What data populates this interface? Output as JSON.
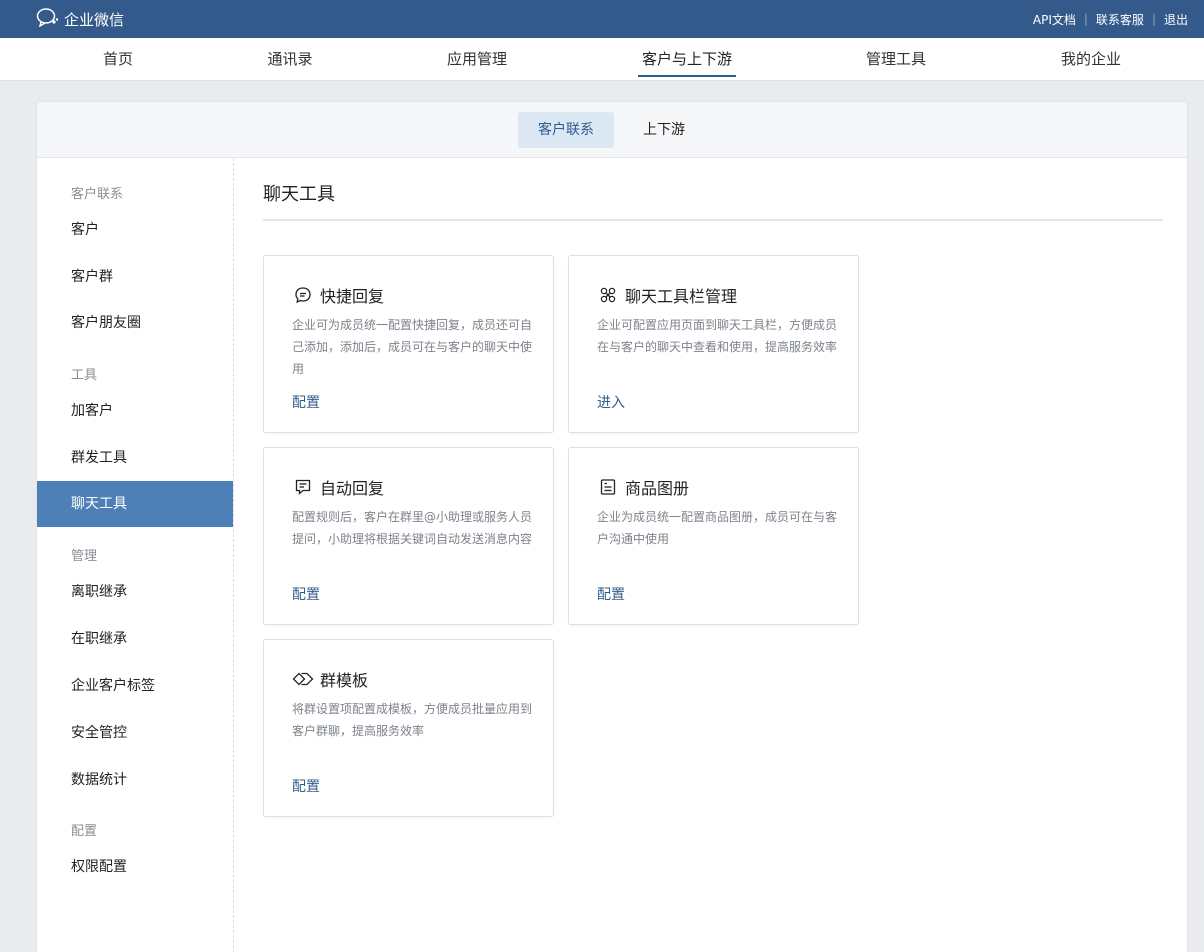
{
  "app": {
    "title": "企业微信"
  },
  "toplinks": [
    "API文档",
    "联系客服",
    "退出"
  ],
  "mainnav": [
    "首页",
    "通讯录",
    "应用管理",
    "客户与上下游",
    "管理工具",
    "我的企业"
  ],
  "subtabs": [
    "客户联系",
    "上下游"
  ],
  "sidebar": {
    "groups": [
      "客户联系",
      "工具",
      "管理",
      "配置"
    ],
    "items": [
      "客户",
      "客户群",
      "客户朋友圈",
      "加客户",
      "群发工具",
      "聊天工具",
      "离职继承",
      "在职继承",
      "企业客户标签",
      "安全管控",
      "数据统计",
      "权限配置"
    ]
  },
  "main": {
    "title": "聊天工具",
    "cards": [
      {
        "title": "快捷回复",
        "icon": "chat-bubble-icon",
        "desc": "企业可为成员统一配置快捷回复，成员还可自己添加，添加后，成员可在与客户的聊天中使用",
        "action": "配置"
      },
      {
        "title": "聊天工具栏管理",
        "icon": "toolbar-icon",
        "desc": "企业可配置应用页面到聊天工具栏，方便成员在与客户的聊天中查看和使用，提高服务效率",
        "action": "进入"
      },
      {
        "title": "自动回复",
        "icon": "auto-reply-icon",
        "desc": "配置规则后，客户在群里@小助理或服务人员提问，小助理将根据关键词自动发送消息内容",
        "action": "配置"
      },
      {
        "title": "商品图册",
        "icon": "catalog-icon",
        "desc": "企业为成员统一配置商品图册，成员可在与客户沟通中使用",
        "action": "配置"
      },
      {
        "title": "群模板",
        "icon": "group-template-icon",
        "desc": "将群设置项配置成模板，方便成员批量应用到客户群聊，提高服务效率",
        "action": "配置"
      }
    ]
  },
  "colors": {
    "topbar": "#335a8a",
    "accent": "#2f5d8e",
    "active_sidebar": "#4e7fb6"
  }
}
